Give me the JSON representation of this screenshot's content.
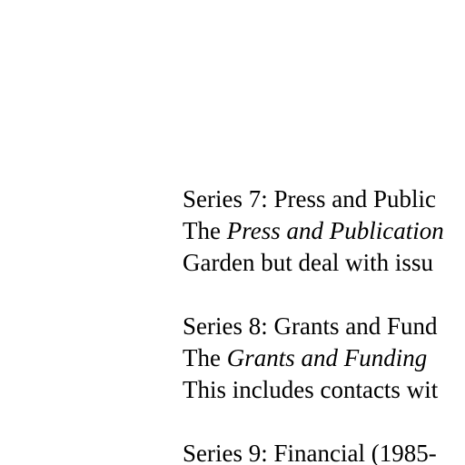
{
  "document": {
    "series7": {
      "heading": "Series 7: Press and Public",
      "line2_prefix": "The ",
      "line2_italic": "Press and Publication",
      "line3": "Garden but deal with issu"
    },
    "series8": {
      "heading": "Series 8: Grants and Fund",
      "line2_prefix": "The ",
      "line2_italic": "Grants and Funding",
      "line3": "This includes contacts wit"
    },
    "series9": {
      "heading": "Series 9: Financial (1985-"
    }
  }
}
